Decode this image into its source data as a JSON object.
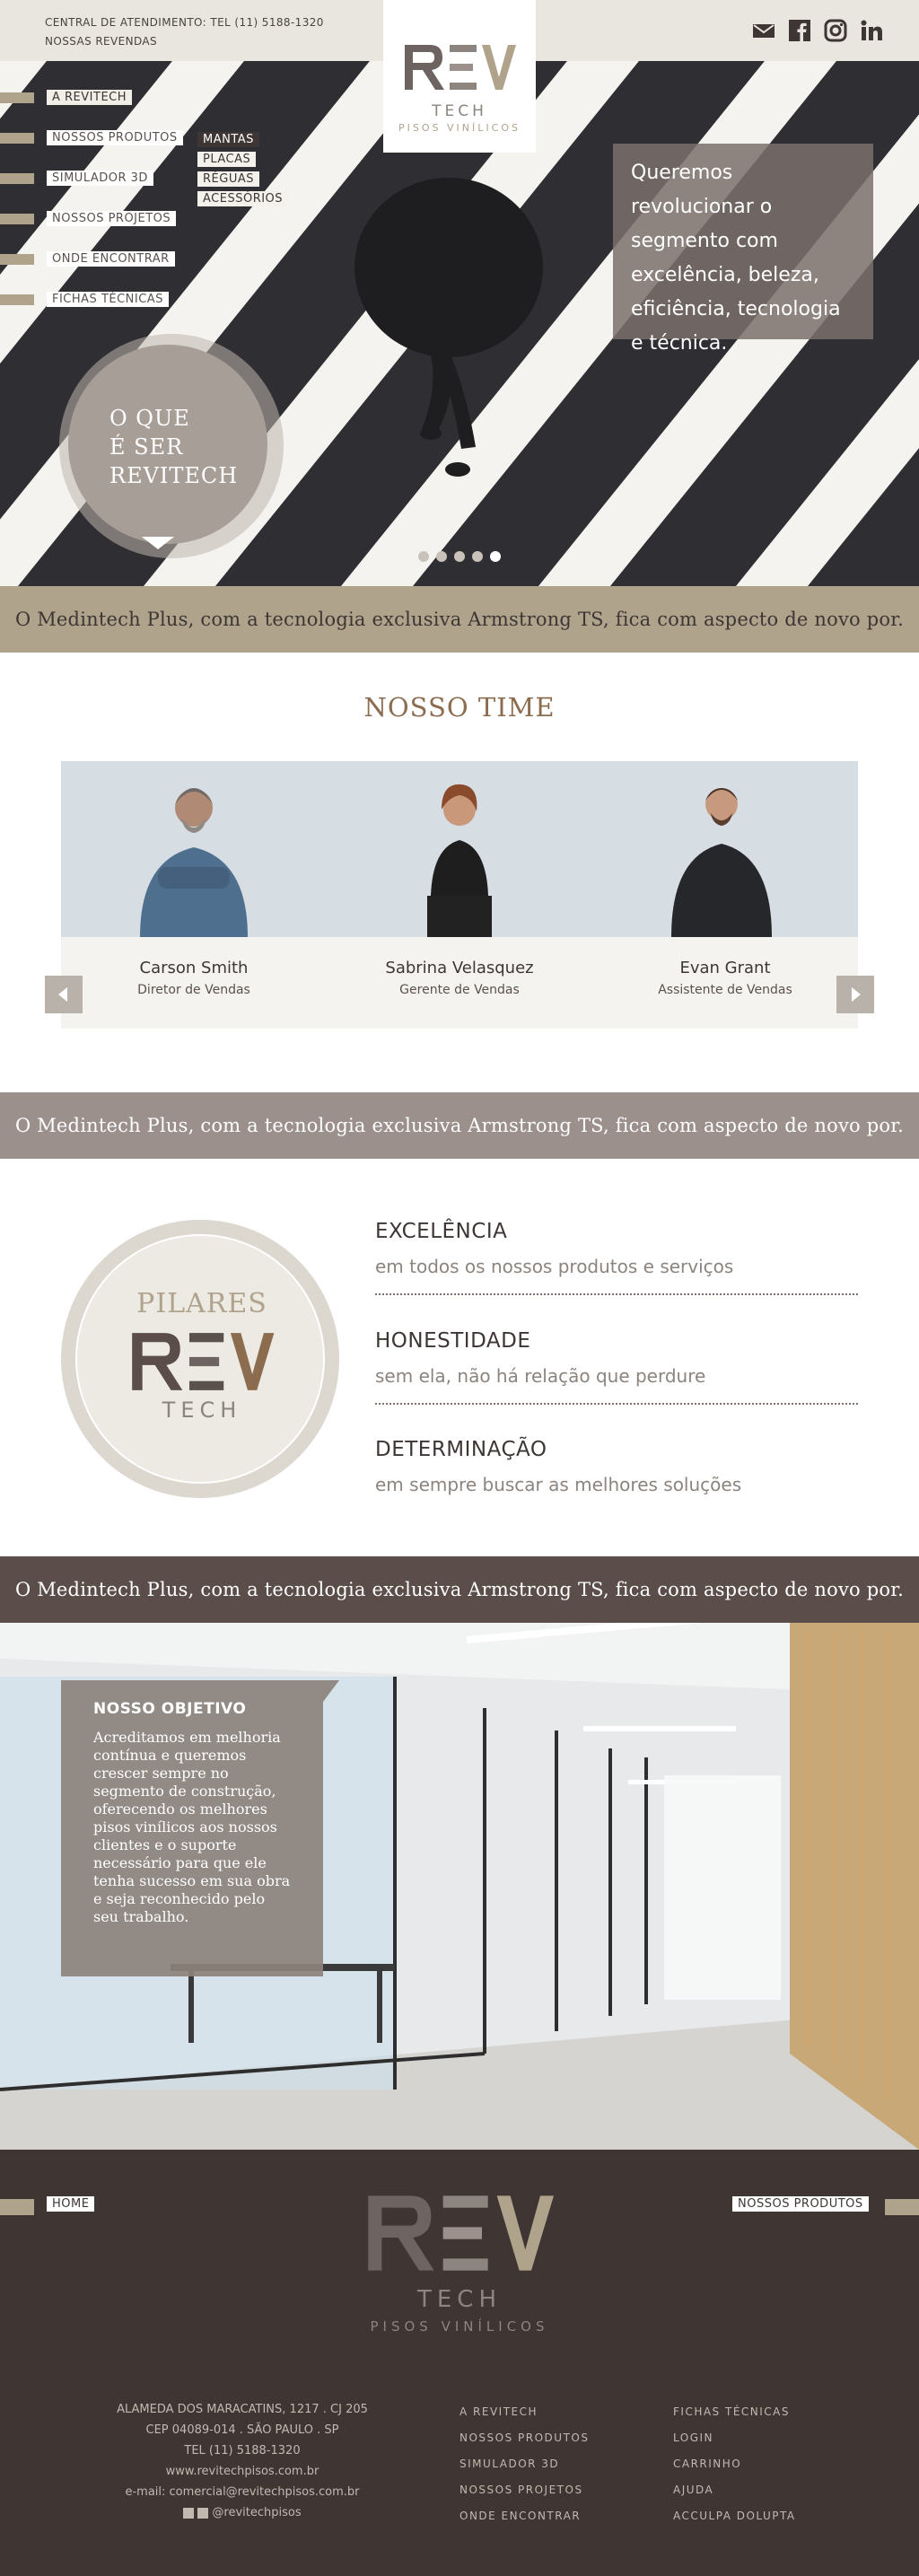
{
  "header": {
    "phone_line": "CENTRAL DE ATENDIMENTO: TEL (11) 5188-1320",
    "resellers": "NOSSAS REVENDAS",
    "logo": {
      "main": "REV",
      "tech": "TECH",
      "sub": "PISOS VINÍLICOS"
    },
    "social": [
      "mail-icon",
      "facebook-icon",
      "instagram-icon",
      "linkedin-icon"
    ]
  },
  "menu": {
    "items": [
      {
        "label": "A REVITECH"
      },
      {
        "label": "NOSSOS PRODUTOS"
      },
      {
        "label": "SIMULADOR 3D"
      },
      {
        "label": "NOSSOS PROJETOS"
      },
      {
        "label": "ONDE ENCONTRAR"
      },
      {
        "label": "FICHAS TÉCNICAS"
      }
    ],
    "submenu": [
      "MANTAS",
      "PLACAS",
      "RÉGUAS",
      "ACESSÓRIOS"
    ]
  },
  "hero": {
    "text": "Queremos revolucionar o segmento com excelência, beleza, eficiência, tecnologia e técnica.",
    "circle_line1": "O QUE",
    "circle_line2": "É SER",
    "circle_line3": "REVITECH",
    "slides": 5,
    "active_slide": 5
  },
  "banner_text": "O Medintech Plus, com a tecnologia exclusiva Armstrong TS, fica com aspecto de novo por.",
  "team": {
    "title": "NOSSO TIME",
    "members": [
      {
        "name": "Carson Smith",
        "role": "Diretor de Vendas"
      },
      {
        "name": "Sabrina Velasquez",
        "role": "Gerente de Vendas"
      },
      {
        "name": "Evan Grant",
        "role": "Assistente de Vendas"
      }
    ]
  },
  "pilares": {
    "title": "PILARES",
    "logo": "REV",
    "tech": "TECH",
    "items": [
      {
        "title": "EXCELÊNCIA",
        "desc": "em todos os nossos produtos e serviços"
      },
      {
        "title": "HONESTIDADE",
        "desc": "sem ela, não há relação que perdure"
      },
      {
        "title": "DETERMINAÇÃO",
        "desc": "em sempre buscar as melhores soluções"
      }
    ]
  },
  "objetivo": {
    "title": "NOSSO OBJETIVO",
    "text": "Acreditamos em melhoria contínua e queremos crescer sempre no segmento de construção, oferecendo os melhores pisos vinílicos aos nossos clientes e o suporte necessário para que ele tenha sucesso em sua obra e seja reconhecido pelo seu trabalho."
  },
  "footer": {
    "home": "HOME",
    "products": "NOSSOS PRODUTOS",
    "logo": {
      "main": "REV",
      "tech": "TECH",
      "sub": "PISOS VINÍLICOS"
    },
    "address": [
      "ALAMEDA DOS MARACATINS, 1217 . CJ 205",
      "CEP 04089-014 . SÃO PAULO . SP",
      "TEL (11) 5188-1320",
      "www.revitechpisos.com.br",
      "e-mail: comercial@revitechpisos.com.br"
    ],
    "social_handle": "@revitechpisos",
    "col1": [
      "A REVITECH",
      "NOSSOS PRODUTOS",
      "SIMULADOR 3D",
      "NOSSOS PROJETOS",
      "ONDE ENCONTRAR"
    ],
    "col2": [
      "FICHAS TÉCNICAS",
      "LOGIN",
      "CARRINHO",
      "AJUDA",
      "ACCULPA DOLUPTA"
    ]
  },
  "colors": {
    "gold": "#b0a38c",
    "taupe": "#9b908b",
    "dark_brown": "#3f3533",
    "banner_dark": "#5a4d4a",
    "cream": "#e9e6df"
  }
}
